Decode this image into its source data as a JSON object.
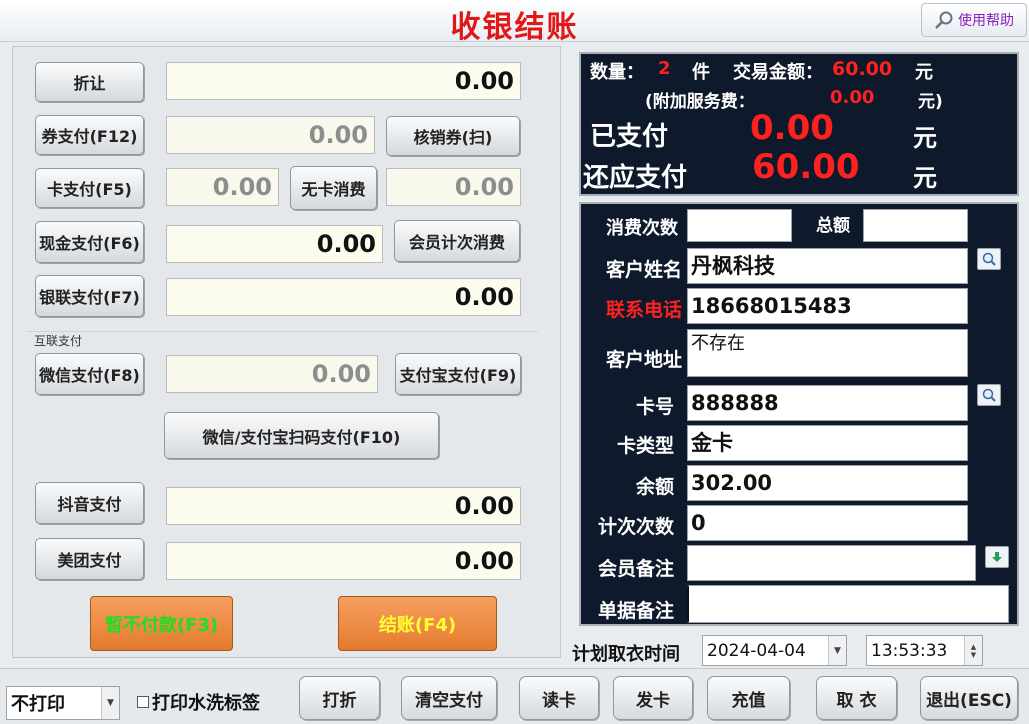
{
  "window": {
    "title": "收银结账",
    "help_label": "使用帮助"
  },
  "payments": {
    "discount": {
      "label": "折让",
      "value": "0.00"
    },
    "coupon": {
      "label": "券支付(F12)",
      "value": "0.00",
      "verify_label": "核销券(扫)"
    },
    "card": {
      "label": "卡支付(F5)",
      "value": "0.00",
      "no_card_label": "无卡消费",
      "no_card_value": "0.00"
    },
    "cash": {
      "label": "现金支付(F6)",
      "value": "0.00",
      "member_count_label": "会员计次消费"
    },
    "unionpay": {
      "label": "银联支付(F7)",
      "value": "0.00"
    },
    "internet_group_label": "互联支付",
    "wechat": {
      "label": "微信支付(F8)",
      "value": "0.00"
    },
    "alipay": {
      "label": "支付宝支付(F9)"
    },
    "scan_label": "微信/支付宝扫码支付(F10)",
    "douyin": {
      "label": "抖音支付",
      "value": "0.00"
    },
    "meituan": {
      "label": "美团支付",
      "value": "0.00"
    },
    "defer_label": "暂不付款(F3)",
    "checkout_label": "结账(F4)"
  },
  "summary": {
    "qty_label": "数量：",
    "qty_value": "2",
    "qty_unit": "件",
    "amount_label": "交易金额：",
    "amount_value": "60.00",
    "amount_unit": "元",
    "service_label": "(附加服务费：",
    "service_value": "0.00",
    "service_unit": "元)",
    "paid_label": "已支付",
    "paid_value": "0.00",
    "paid_unit": "元",
    "due_label": "还应支付",
    "due_value": "60.00",
    "due_unit": "元"
  },
  "member": {
    "visits_label": "消费次数",
    "visits_value": "",
    "total_label": "总额",
    "total_value": "",
    "name_label": "客户姓名",
    "name_value": "丹枫科技",
    "phone_label": "联系电话",
    "phone_value": "18668015483",
    "address_label": "客户地址",
    "address_value": "不存在",
    "card_no_label": "卡号",
    "card_no_value": "888888",
    "card_type_label": "卡类型",
    "card_type_value": "金卡",
    "balance_label": "余额",
    "balance_value": "302.00",
    "count_label": "计次次数",
    "count_value": "0",
    "member_note_label": "会员备注",
    "member_note_value": "",
    "order_note_label": "单据备注",
    "order_note_value": ""
  },
  "pickup": {
    "label": "计划取衣时间",
    "date": "2024-04-04",
    "time": "13:53:33"
  },
  "toolbar": {
    "print_option": "不打印",
    "wash_label_checkbox": "打印水洗标签",
    "reprint": "打折",
    "clear_payment": "清空支付",
    "read_card": "读卡",
    "issue_card": "发卡",
    "recharge": "充值",
    "pickup": "取 衣",
    "exit": "退出(ESC)"
  },
  "colors": {
    "title": "#e01818",
    "panel_dark": "#0e1a2b",
    "accent_red": "#ff2020",
    "defer_text": "#22dd22",
    "checkout_text": "#ffff30"
  }
}
